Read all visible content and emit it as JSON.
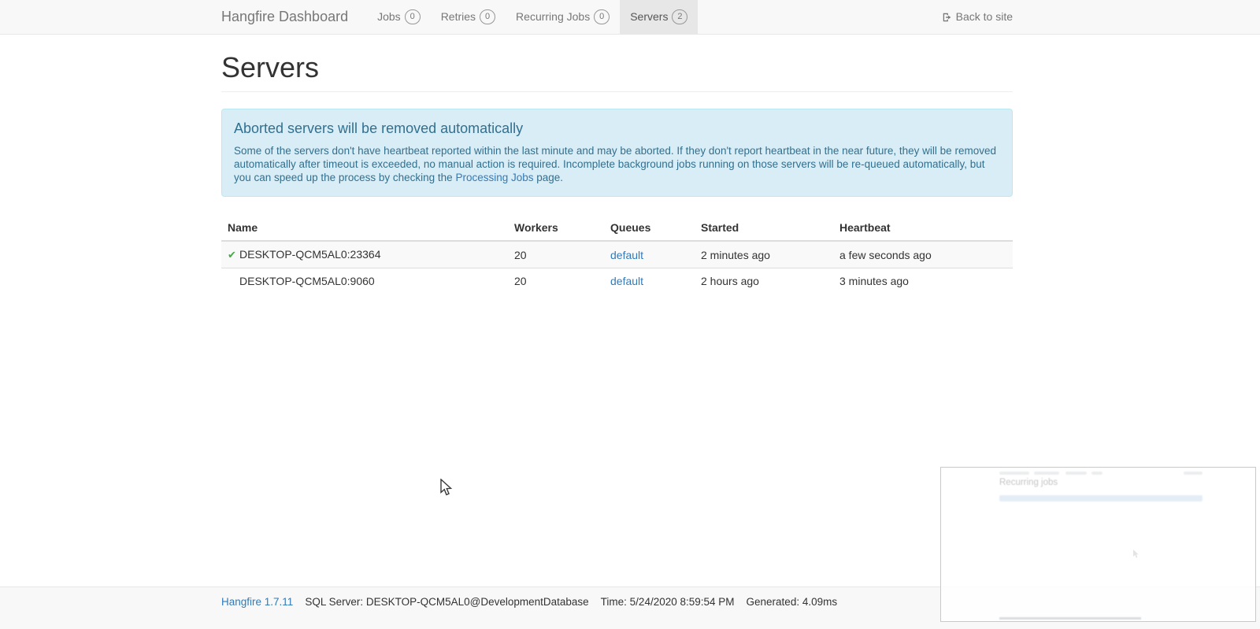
{
  "navbar": {
    "brand": "Hangfire Dashboard",
    "items": [
      {
        "label": "Jobs",
        "count": "0"
      },
      {
        "label": "Retries",
        "count": "0"
      },
      {
        "label": "Recurring Jobs",
        "count": "0"
      },
      {
        "label": "Servers",
        "count": "2"
      }
    ],
    "back_to_site": "Back to site"
  },
  "page": {
    "title": "Servers"
  },
  "alert": {
    "title": "Aborted servers will be removed automatically",
    "body_before_link": "Some of the servers don't have heartbeat reported within the last minute and may be aborted. If they don't report heartbeat in the near future, they will be removed automatically after timeout is exceeded, no manual action is required. Incomplete background jobs running on those servers will be re-queued automatically, but you can speed up the process by checking the ",
    "link_text": "Processing Jobs",
    "body_after_link": " page."
  },
  "table": {
    "headers": [
      "Name",
      "Workers",
      "Queues",
      "Started",
      "Heartbeat"
    ],
    "rows": [
      {
        "active_icon": "✔",
        "name": "DESKTOP-QCM5AL0:23364",
        "workers": "20",
        "queues": "default",
        "started": "2 minutes ago",
        "heartbeat": "a few seconds ago"
      },
      {
        "active_icon": "",
        "name": "DESKTOP-QCM5AL0:9060",
        "workers": "20",
        "queues": "default",
        "started": "2 hours ago",
        "heartbeat": "3 minutes ago"
      }
    ]
  },
  "footer": {
    "version": "Hangfire 1.7.11",
    "storage": "SQL Server: DESKTOP-QCM5AL0@DevelopmentDatabase",
    "time": "Time: 5/24/2020 8:59:54 PM",
    "generated": "Generated: 4.09ms"
  },
  "ghost_preview": {
    "title": "Recurring jobs"
  },
  "colors": {
    "navbar_bg": "#f8f8f8",
    "navbar_border": "#e7e7e7",
    "nav_text": "#777777",
    "active_tab_bg": "#e7e7e7",
    "alert_bg": "#d9edf7",
    "alert_border": "#bce8f1",
    "alert_text": "#31708f",
    "link": "#337ab7",
    "success_check": "#4aa64a",
    "stripe_row": "#f9f9f9",
    "table_border": "#dddddd"
  }
}
